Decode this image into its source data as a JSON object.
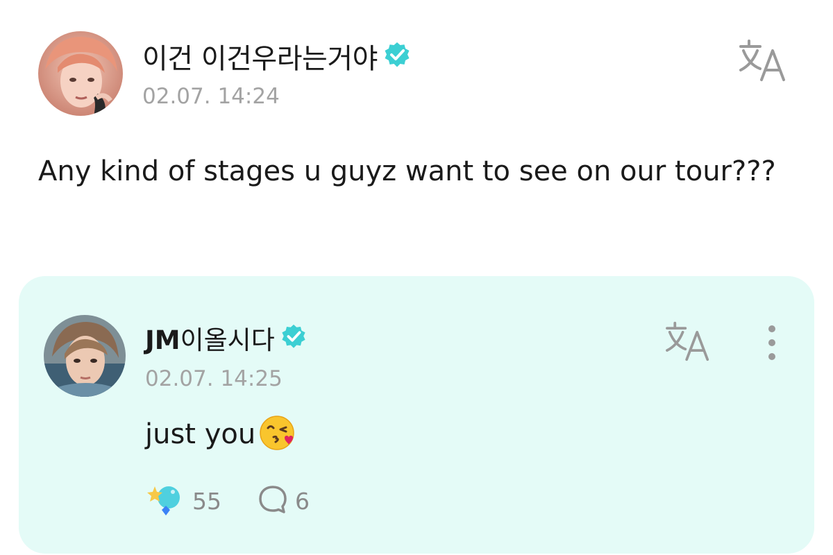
{
  "post": {
    "author_name": "이건 이건우라는거야",
    "timestamp": "02.07. 14:24",
    "body": "Any kind of stages u guyz want to see on our tour???",
    "verified_icon": "verified-badge-icon",
    "translate_icon": "translate-icon"
  },
  "reply": {
    "author_name_latin": "JM",
    "author_name_korean": "이올시다",
    "timestamp": "02.07. 14:25",
    "body": "just you",
    "body_emoji": "kissing-face-with-heart-emoji",
    "verified_icon": "verified-badge-icon",
    "translate_icon": "translate-icon",
    "more_icon": "more-vertical-icon",
    "like_count": "55",
    "comment_count": "6",
    "like_icon": "sparkle-reaction-icon",
    "comment_icon": "comment-bubble-icon"
  },
  "colors": {
    "reply_card_background": "#e4fbf7",
    "verified_badge": "#3ccfd3",
    "muted_text": "#a3a3a3",
    "primary_text": "#1a1a1a"
  }
}
